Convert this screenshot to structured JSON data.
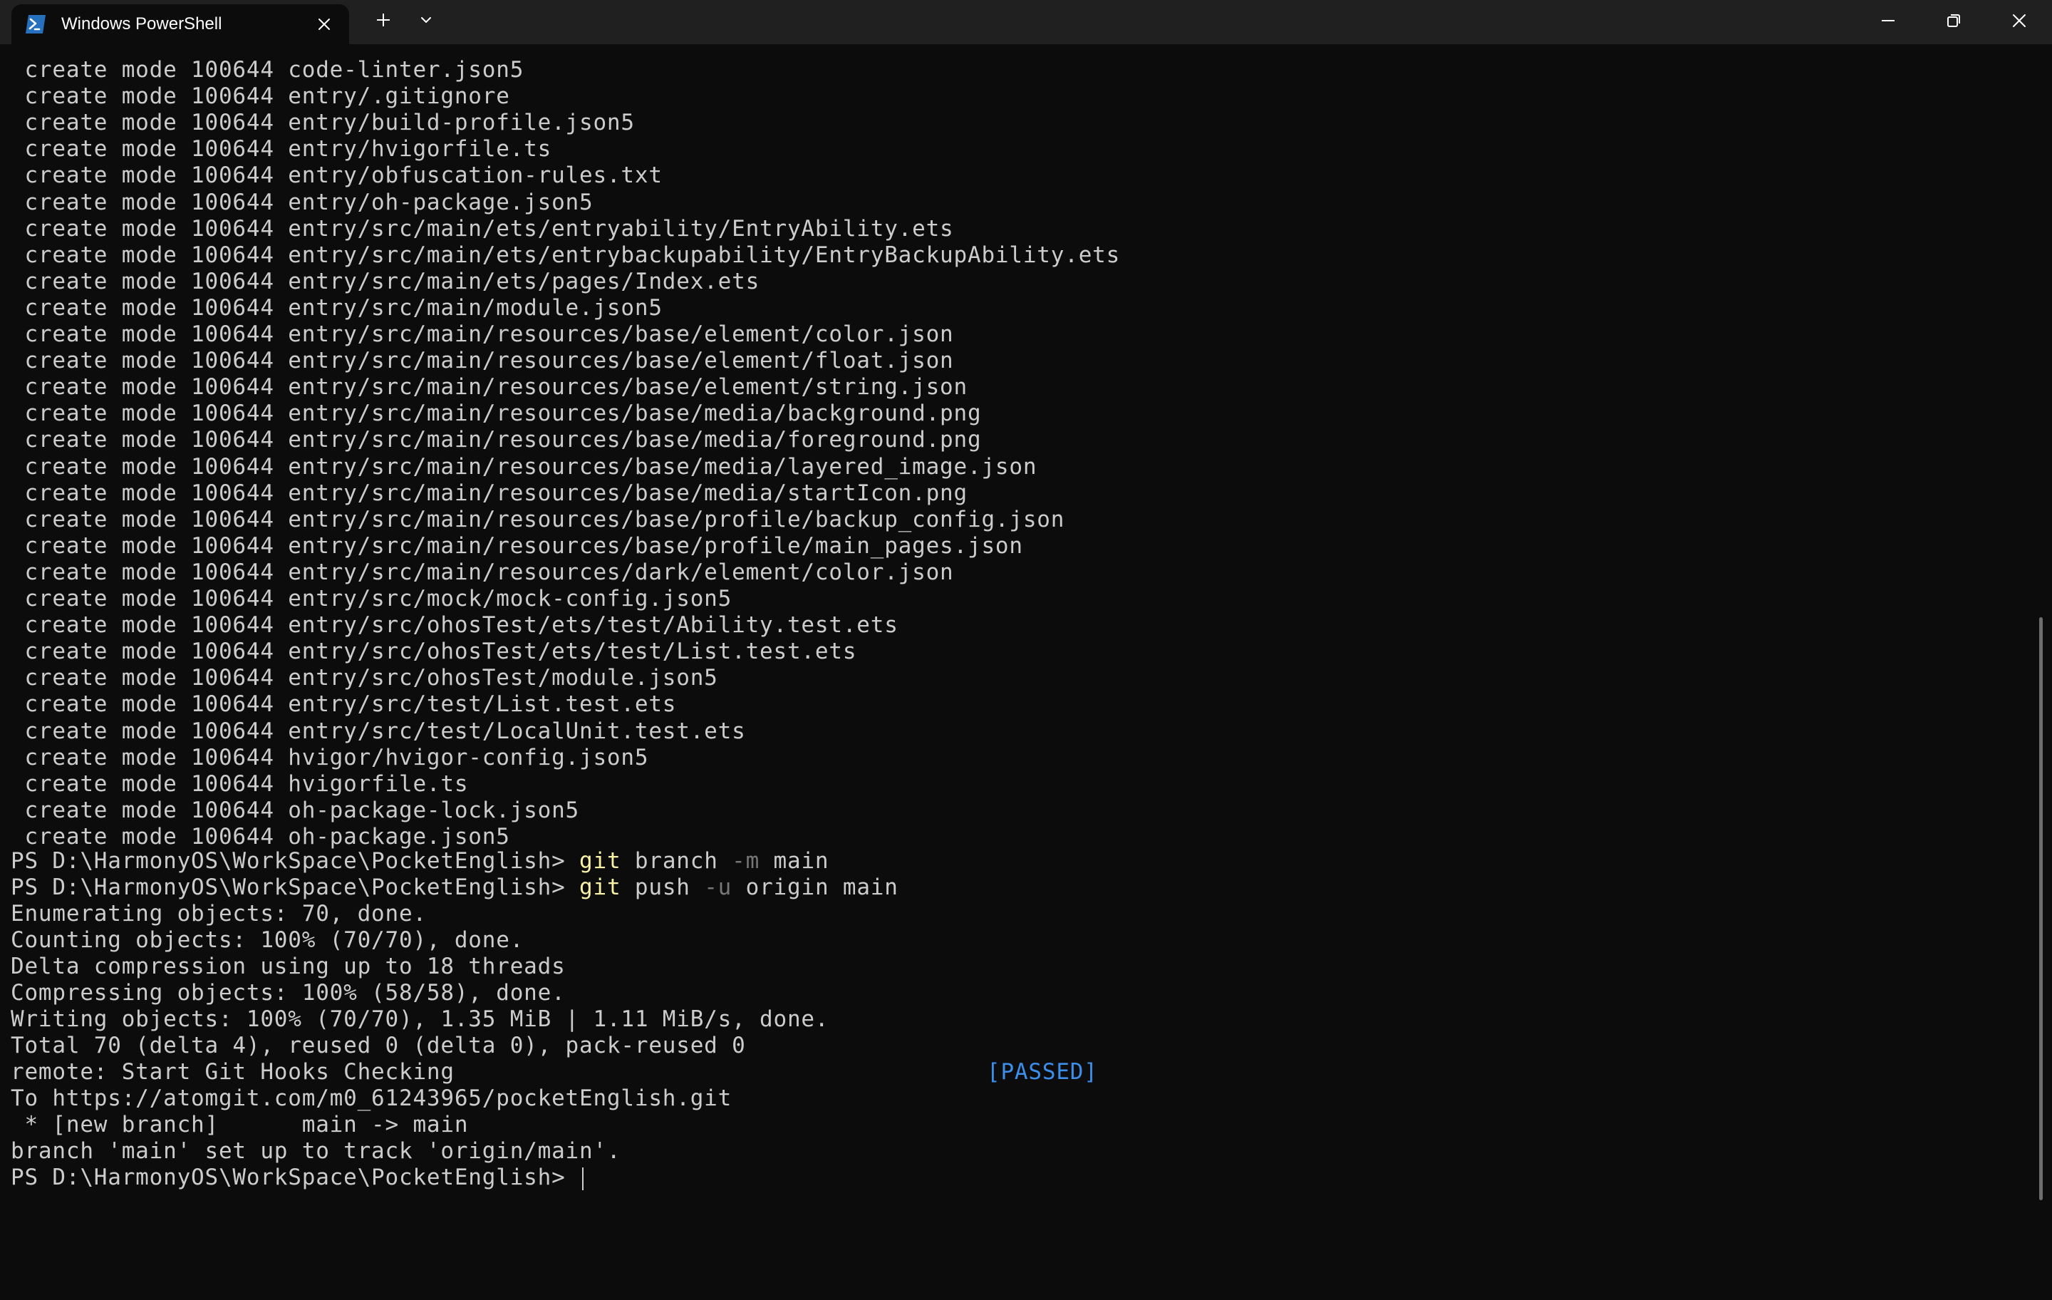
{
  "window": {
    "tab_title": "Windows PowerShell",
    "icons": {
      "tab_icon": "powershell-icon",
      "tab_close": "close-icon",
      "new_tab": "plus-icon",
      "dropdown": "chevron-down-icon",
      "minimize": "minimize-icon",
      "restore": "restore-icon",
      "close": "close-icon"
    }
  },
  "colors": {
    "background": "#0c0c0c",
    "titlebar": "#202020",
    "text": "#cccccc",
    "command": "#f9f1a5",
    "parameter": "#767676",
    "passed": "#3b8eea"
  },
  "terminal": {
    "create_lines": [
      " create mode 100644 code-linter.json5",
      " create mode 100644 entry/.gitignore",
      " create mode 100644 entry/build-profile.json5",
      " create mode 100644 entry/hvigorfile.ts",
      " create mode 100644 entry/obfuscation-rules.txt",
      " create mode 100644 entry/oh-package.json5",
      " create mode 100644 entry/src/main/ets/entryability/EntryAbility.ets",
      " create mode 100644 entry/src/main/ets/entrybackupability/EntryBackupAbility.ets",
      " create mode 100644 entry/src/main/ets/pages/Index.ets",
      " create mode 100644 entry/src/main/module.json5",
      " create mode 100644 entry/src/main/resources/base/element/color.json",
      " create mode 100644 entry/src/main/resources/base/element/float.json",
      " create mode 100644 entry/src/main/resources/base/element/string.json",
      " create mode 100644 entry/src/main/resources/base/media/background.png",
      " create mode 100644 entry/src/main/resources/base/media/foreground.png",
      " create mode 100644 entry/src/main/resources/base/media/layered_image.json",
      " create mode 100644 entry/src/main/resources/base/media/startIcon.png",
      " create mode 100644 entry/src/main/resources/base/profile/backup_config.json",
      " create mode 100644 entry/src/main/resources/base/profile/main_pages.json",
      " create mode 100644 entry/src/main/resources/dark/element/color.json",
      " create mode 100644 entry/src/mock/mock-config.json5",
      " create mode 100644 entry/src/ohosTest/ets/test/Ability.test.ets",
      " create mode 100644 entry/src/ohosTest/ets/test/List.test.ets",
      " create mode 100644 entry/src/ohosTest/module.json5",
      " create mode 100644 entry/src/test/List.test.ets",
      " create mode 100644 entry/src/test/LocalUnit.test.ets",
      " create mode 100644 hvigor/hvigor-config.json5",
      " create mode 100644 hvigorfile.ts",
      " create mode 100644 oh-package-lock.json5",
      " create mode 100644 oh-package.json5"
    ],
    "prompt": "PS D:\\HarmonyOS\\WorkSpace\\PocketEnglish> ",
    "cmd1": {
      "program": "git",
      "arg1": " branch ",
      "flag": "-m",
      "arg2": " main"
    },
    "cmd2": {
      "program": "git",
      "arg1": " push ",
      "flag": "-u",
      "arg2": " origin main"
    },
    "output": {
      "enumerating": "Enumerating objects: 70, done.",
      "counting": "Counting objects: 100% (70/70), done.",
      "delta": "Delta compression using up to 18 threads",
      "compressing": "Compressing objects: 100% (58/58), done.",
      "writing": "Writing objects: 100% (70/70), 1.35 MiB | 1.11 MiB/s, done.",
      "total": "Total 70 (delta 4), reused 0 (delta 0), pack-reused 0",
      "remote": "remote: Start Git Hooks Checking",
      "passed": "[PASSED]",
      "to": "To https://atomgit.com/m0_61243965/pocketEnglish.git",
      "new_branch": " * [new branch]      main -> main",
      "tracking": "branch 'main' set up to track 'origin/main'."
    }
  }
}
